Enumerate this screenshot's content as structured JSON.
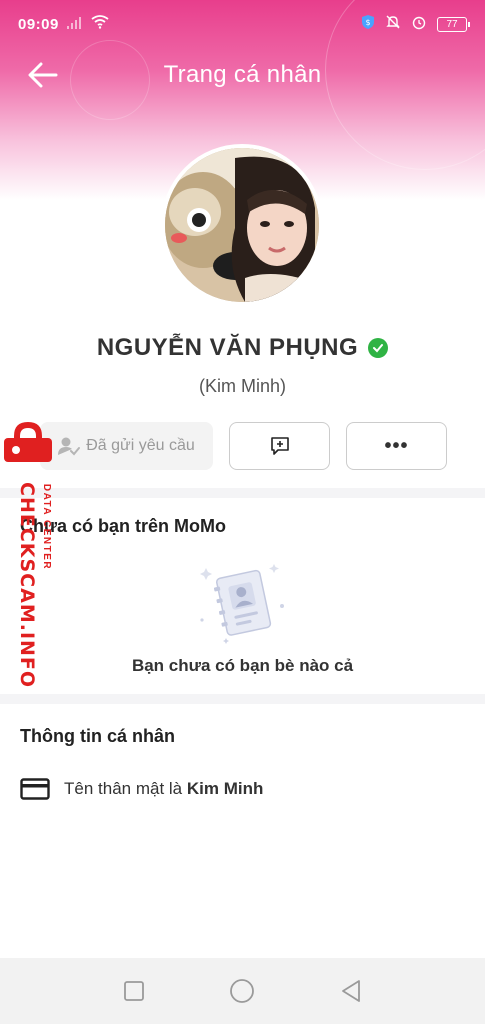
{
  "status_bar": {
    "time": "09:09",
    "battery": "77"
  },
  "header": {
    "title": "Trang cá nhân"
  },
  "profile": {
    "name": "NGUYỄN VĂN PHỤNG",
    "nickname": "(Kim Minh)",
    "verified": true
  },
  "actions": {
    "request_label": "Đã gửi yêu cầu"
  },
  "friends_section": {
    "title": "Chưa có bạn trên MoMo",
    "empty_text": "Bạn chưa có bạn bè nào cả"
  },
  "info_section": {
    "title": "Thông tin cá nhân",
    "nickname_prefix": "Tên thân mật là",
    "nickname_value": "Kim Minh"
  },
  "watermark": {
    "brand": "CHECKSCAM.INFO",
    "tagline": "DATA CENTER"
  },
  "colors": {
    "accent": "#e83e8c",
    "verified": "#2fb344",
    "watermark": "#e02020"
  },
  "icons": [
    "back-arrow-icon",
    "wifi-icon",
    "signal-icon",
    "shield-icon",
    "bell-off-icon",
    "alarm-icon",
    "battery-icon",
    "verified-check-icon",
    "user-check-icon",
    "chat-plus-icon",
    "more-dots-icon",
    "contact-book-icon",
    "card-icon",
    "square-icon",
    "circle-icon",
    "triangle-back-icon",
    "lock-icon"
  ]
}
